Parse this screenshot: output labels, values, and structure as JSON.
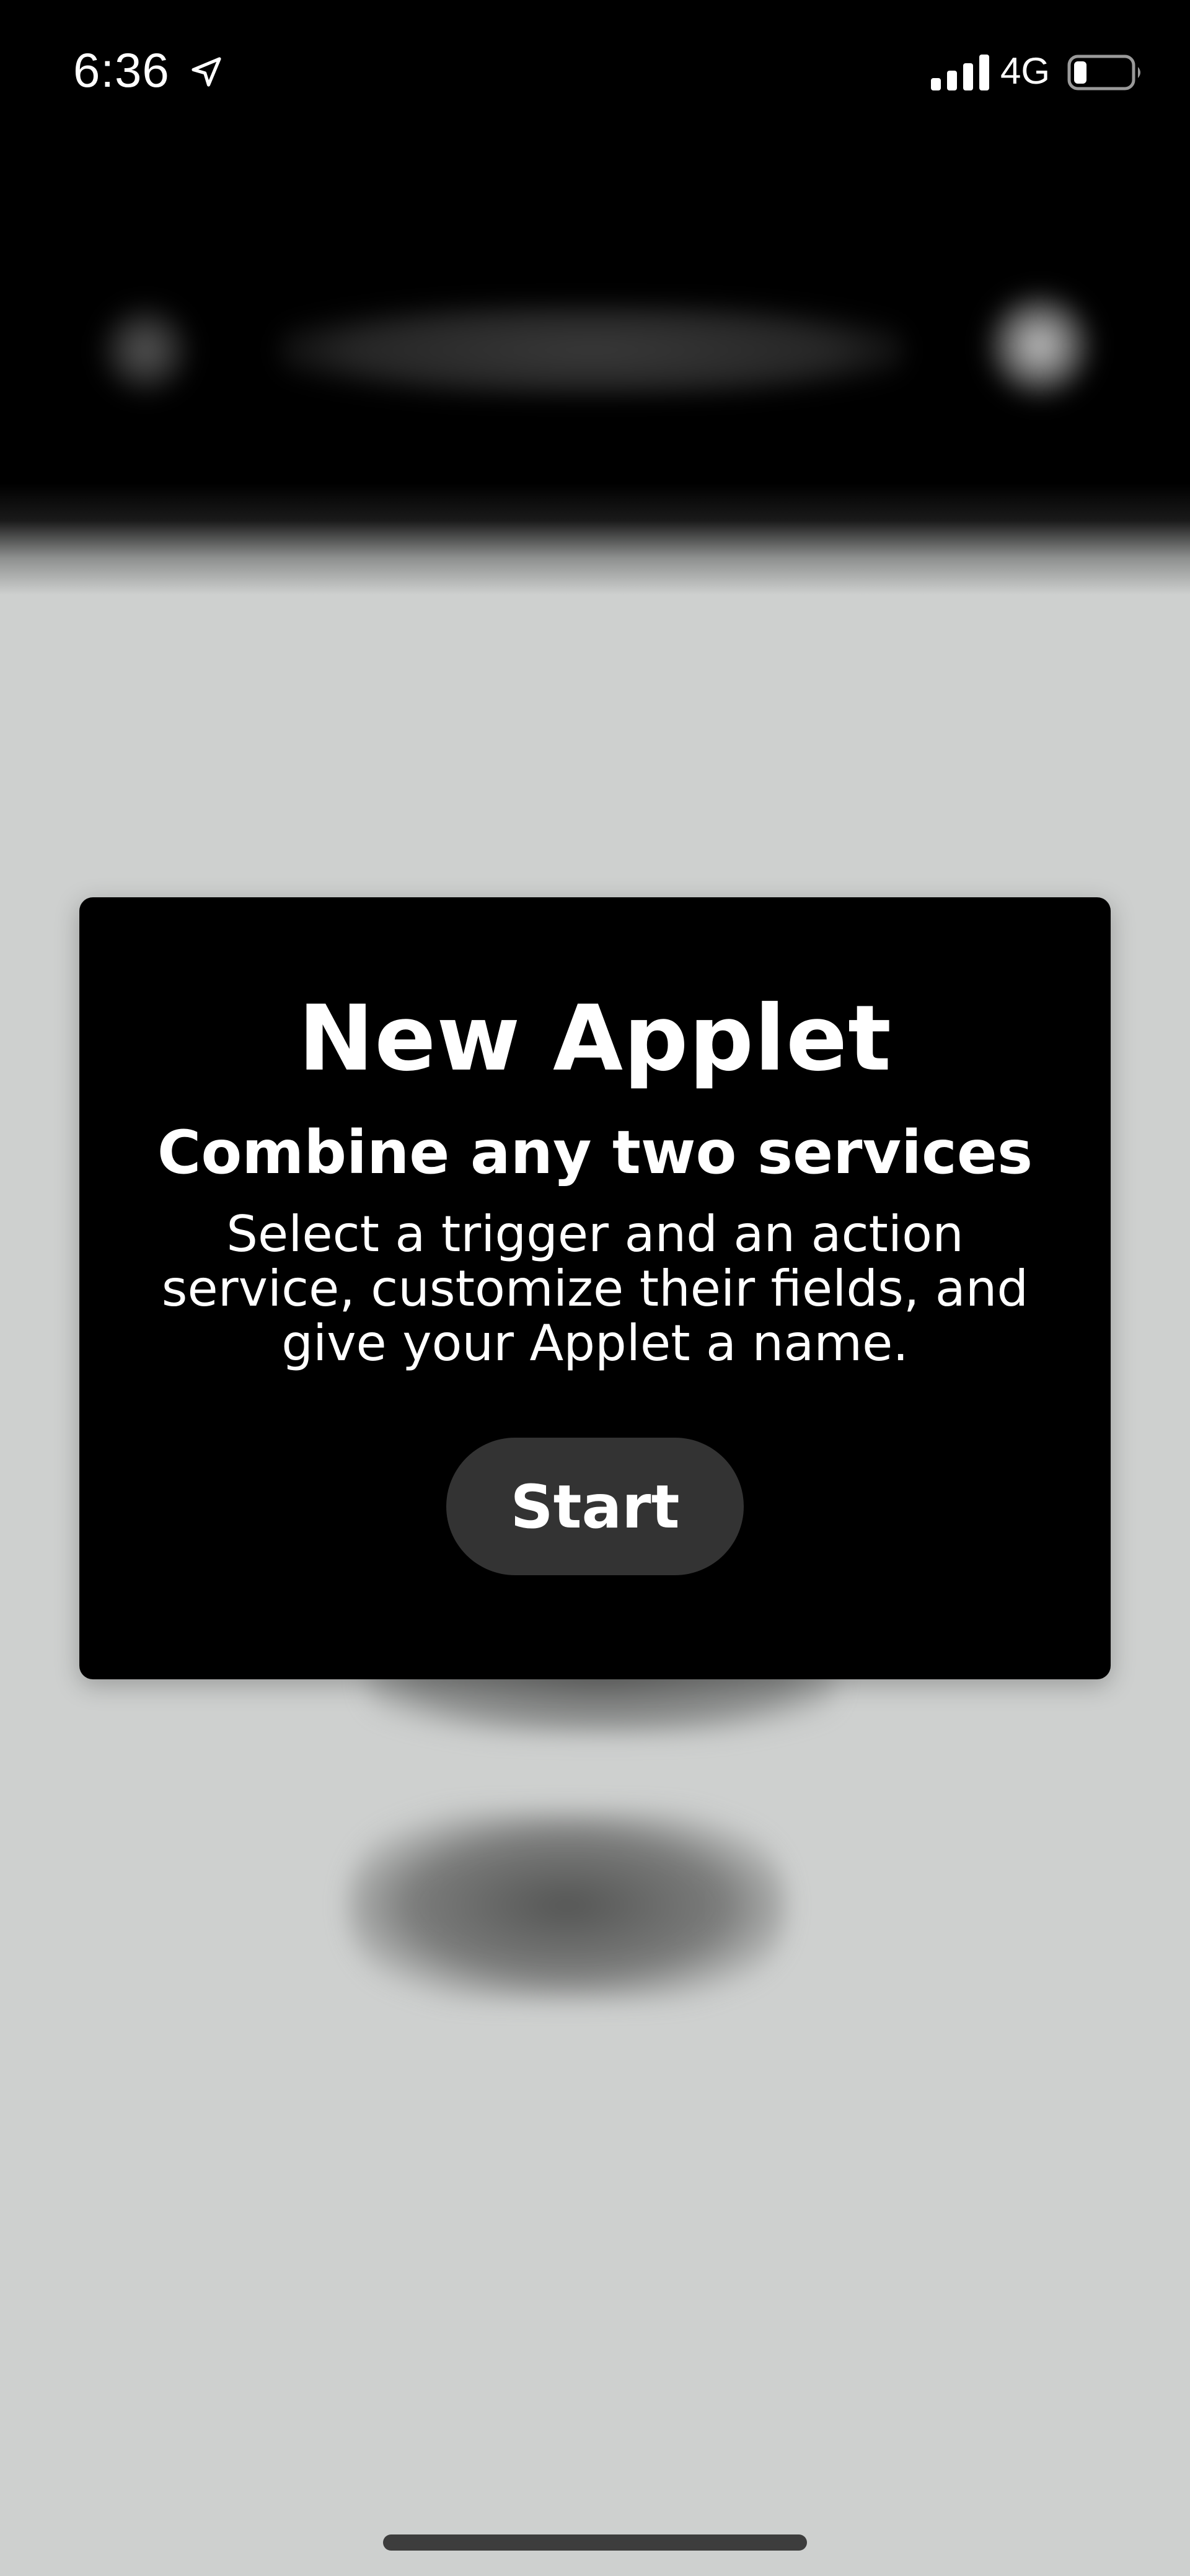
{
  "status_bar": {
    "time": "6:36",
    "network": "4G",
    "icons": [
      "location-arrow-icon",
      "signal-bars-icon",
      "battery-icon"
    ]
  },
  "modal": {
    "title": "New Applet",
    "subtitle": "Combine any two services",
    "description": "Select a trigger and an action service, customize their fields, and give your Applet a name.",
    "start_label": "Start"
  },
  "colors": {
    "background": "#ced0cf",
    "modal_background": "#000000",
    "button_background": "#333333",
    "text": "#ffffff"
  }
}
